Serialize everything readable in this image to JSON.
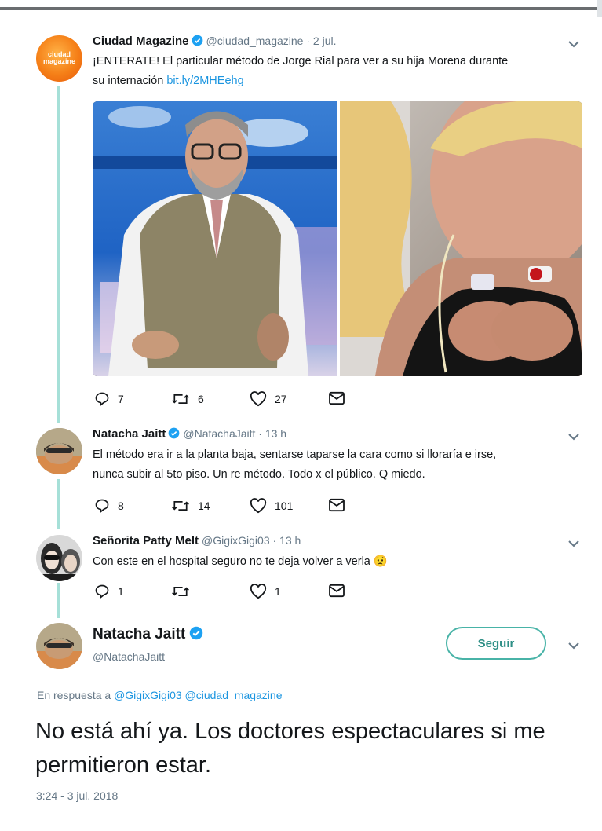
{
  "colors": {
    "accent": "#1b95e0",
    "thread_line": "#a6e0d8",
    "follow_border": "#48b3a7",
    "muted": "#657786",
    "verified": "#1da1f2"
  },
  "tweets": [
    {
      "avatar_text": "ciudad magazine",
      "name": "Ciudad Magazine",
      "handle": "@ciudad_magazine · 2 jul.",
      "text_line1": "¡ENTERATE! El particular método de Jorge Rial para ver a su hija Morena durante",
      "text_line2_plain": "su internación ",
      "link": "bit.ly/2MHEehg",
      "replies": "7",
      "retweets": "6",
      "likes": "27"
    },
    {
      "name": "Natacha Jaitt",
      "handle": "@NatachaJaitt · 13 h",
      "text_line1": "El método era ir a la planta baja, sentarse taparse la cara como si lloraría e irse,",
      "text_line2": "nunca subir al 5to piso. Un re método. Todo x el público. Q miedo.",
      "replies": "8",
      "retweets": "14",
      "likes": "101"
    },
    {
      "name": "Señorita Patty Melt",
      "handle": "@GigixGigi03 · 13 h",
      "text": "Con este en el hospital seguro no te deja volver a verla",
      "emoji": "😟",
      "replies": "1",
      "retweets": "",
      "likes": "1"
    }
  ],
  "main_tweet": {
    "name": "Natacha Jaitt",
    "handle": "@NatachaJaitt",
    "follow_label": "Seguir",
    "reply_prefix": "En respuesta a",
    "reply_mentions": "@GigixGigi03 @ciudad_magazine",
    "text": "No está ahí ya. Los doctores espectaculares si me permitieron estar.",
    "timestamp": "3:24 - 3 jul. 2018"
  },
  "icons": [
    "reply-icon",
    "retweet-icon",
    "like-icon",
    "message-icon",
    "verified-icon",
    "chevron-down-icon"
  ]
}
